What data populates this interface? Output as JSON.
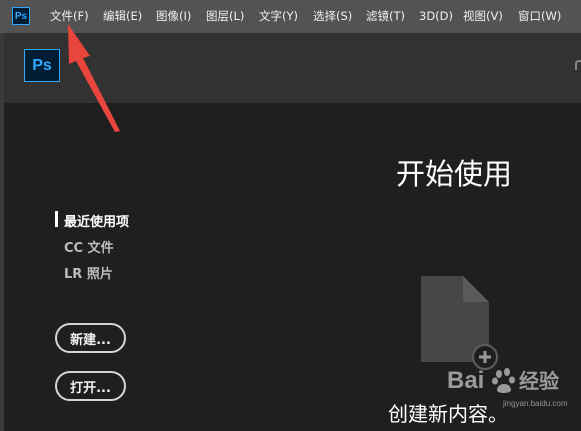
{
  "app": {
    "icon_label": "Ps",
    "logo_label": "Ps"
  },
  "menu": [
    {
      "label": "文件(F)"
    },
    {
      "label": "编辑(E)"
    },
    {
      "label": "图像(I)"
    },
    {
      "label": "图层(L)"
    },
    {
      "label": "文字(Y)"
    },
    {
      "label": "选择(S)"
    },
    {
      "label": "滤镜(T)"
    },
    {
      "label": "3D(D)"
    },
    {
      "label": "视图(V)"
    },
    {
      "label": "窗口(W)"
    }
  ],
  "nav": {
    "recent": "最近使用项",
    "cc_files": "CC 文件",
    "lr_photos": "LR 照片"
  },
  "buttons": {
    "new_label": "新建...",
    "open_label": "打开..."
  },
  "main": {
    "title": "开始使用",
    "create_label": "创建新内容。"
  },
  "watermark": {
    "brand": "Bai",
    "brand2": "经验",
    "site": "jingyan.baidu.com"
  },
  "colors": {
    "menubar": "#535353",
    "panel": "#323232",
    "background": "#1f1f1f",
    "ps_blue": "#31a8ff",
    "annotation_red": "#e8453c"
  }
}
